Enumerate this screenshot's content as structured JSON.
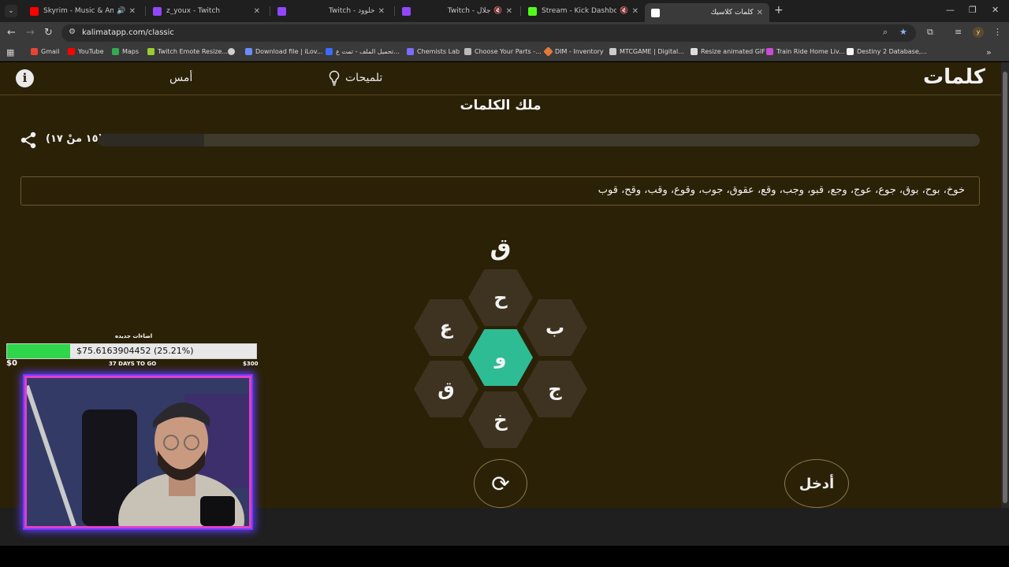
{
  "browser": {
    "tabs": [
      {
        "title": "Skyrim - Music & Ambience",
        "favicon_color": "#ff0000",
        "audio": true
      },
      {
        "title": "z_youx - Twitch",
        "favicon_color": "#9146ff"
      },
      {
        "title": "Twitch - خلوود",
        "favicon_color": "#9146ff"
      },
      {
        "title": "Twitch - جلال",
        "favicon_color": "#9146ff",
        "muted": true
      },
      {
        "title": "Stream - Kick Dashboard",
        "favicon_color": "#53fc18",
        "muted": true
      },
      {
        "title": "كلمات كلاسيك",
        "favicon_color": "#ffffff",
        "active": true
      }
    ],
    "url": "kalimatapp.com/classic",
    "profile_initial": "y",
    "bookmarks": [
      {
        "label": "Gmail",
        "color": "#ea4335"
      },
      {
        "label": "YouTube",
        "color": "#ff0000"
      },
      {
        "label": "Maps",
        "color": "#34a853"
      },
      {
        "label": "Twitch Emote Resize...",
        "color": "#9acd32"
      },
      {
        "label": "",
        "color": "#cfcfcf"
      },
      {
        "label": "Download file | iLov...",
        "color": "#6a8cff"
      },
      {
        "label": "تحميل الملف - تمت ع...",
        "color": "#3b6cff"
      },
      {
        "label": "Chemists Lab",
        "color": "#7a6cff"
      },
      {
        "label": "Choose Your Parts -...",
        "color": "#bbbbbb"
      },
      {
        "label": "DIM - Inventory",
        "color": "#e07b39"
      },
      {
        "label": "MTCGAME | Digital...",
        "color": "#cccccc"
      },
      {
        "label": "Resize animated GIF",
        "color": "#dddddd"
      },
      {
        "label": "Train Ride Home Liv...",
        "color": "#c94bd6"
      },
      {
        "label": "Destiny 2 Database,...",
        "color": "#f5f5f5"
      }
    ]
  },
  "app": {
    "logo": "كلمات",
    "hints_label": "تلميحات",
    "yesterday_label": "أمس",
    "info_label": "i",
    "rank_title": "ملك الكلمات",
    "progress_text": "(١٥ منْ ١٧)",
    "progress_fraction": 0.12,
    "found_words": "خوخ، بوح، بوق، جوع، عوج، وجع، قبو، وجب، وقع، عقوق، جوب، وقوع، وقب، وقح، قوب",
    "current_word": "ق",
    "letters": {
      "center": "و",
      "top": "ح",
      "top_right": "ب",
      "top_left": "ع",
      "bottom_right": "ج",
      "bottom_left": "ق",
      "bottom": "خ"
    },
    "enter_label": "أدخل",
    "accent_color": "#2ebc94",
    "background_color": "#2b2107"
  },
  "overlay": {
    "goal_title": "اضاءات جديده",
    "goal_text": "$75.6163904452 (25.21%)",
    "goal_fraction": 0.2521,
    "goal_min": "$0",
    "goal_max": "$300",
    "goal_days": "37 DAYS TO GO"
  }
}
